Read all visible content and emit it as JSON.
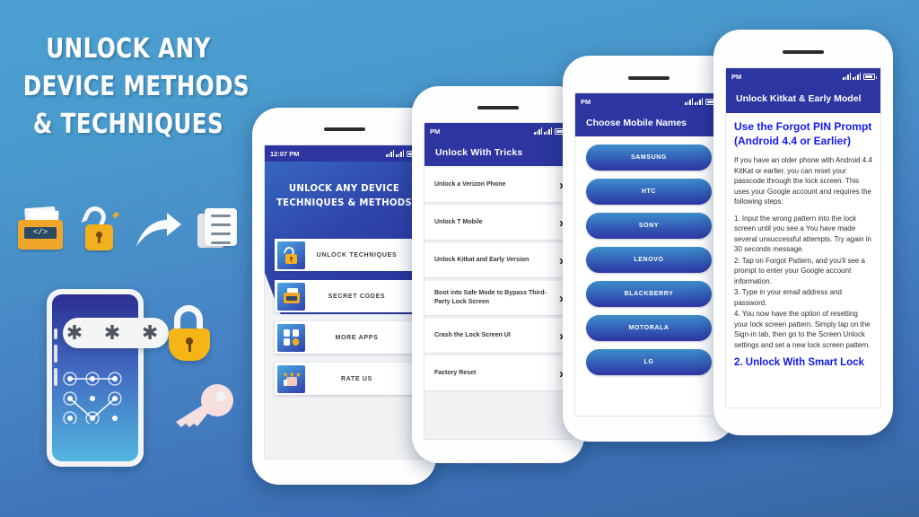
{
  "background": {
    "top_color": "#4b9fd0",
    "bottom_color": "#38679f"
  },
  "headline": {
    "line1": "UNLOCK ANY",
    "line2": "DEVICE METHODS",
    "line3": "& TECHNIQUES"
  },
  "decor_icons": [
    {
      "name": "folder-code-icon",
      "code_label": "</>"
    },
    {
      "name": "unlocked-padlock-icon"
    },
    {
      "name": "forward-arrow-icon"
    },
    {
      "name": "documents-icon"
    }
  ],
  "illustration": {
    "name": "phone-pattern-lock-illustration",
    "password_mask": "✱ ✱ ✱",
    "lock_icon": "padlock-open-icon",
    "key_icon": "key-icon"
  },
  "phones": [
    {
      "id": "phone-home",
      "statusbar": {
        "time": "12:07 PM",
        "signal": "signal-bars-icon",
        "battery": "battery-icon"
      },
      "hero_title_line1": "UNLOCK ANY DEVICE",
      "hero_title_line2": "TECHNIQUES & METHODS",
      "tiles": [
        {
          "label": "UNLOCK TECHNIQUES",
          "icon": "unlock-techniques-icon"
        },
        {
          "label": "SECRET CODES",
          "icon": "secret-codes-icon"
        },
        {
          "label": "MORE APPS",
          "icon": "more-apps-icon"
        },
        {
          "label": "RATE US",
          "icon": "rate-us-icon"
        }
      ]
    },
    {
      "id": "phone-tricks",
      "statusbar": {
        "time": "PM",
        "signal": "signal-bars-icon",
        "battery": "battery-icon"
      },
      "appbar_title": "Unlock With Tricks",
      "rows": [
        {
          "label": "Unlock a Verizon Phone"
        },
        {
          "label": "Unlock T Mobile"
        },
        {
          "label": "Unlock Kitkat and Early Version"
        },
        {
          "label": "Boot into Safe Mode to Bypass Third-Party Lock Screen"
        },
        {
          "label": "Crash the Lock Screen UI"
        },
        {
          "label": "Factory Reset"
        }
      ],
      "chevron": "›"
    },
    {
      "id": "phone-brands",
      "statusbar": {
        "time": "PM",
        "signal": "signal-bars-icon",
        "battery": "battery-icon"
      },
      "appbar_title": "Choose Mobile Names",
      "brands": [
        "SAMSUNG",
        "HTC",
        "SONY",
        "LENOVO",
        "BLACKBERRY",
        "MOTORALA",
        "LG"
      ]
    },
    {
      "id": "phone-article",
      "statusbar": {
        "time": "PM",
        "signal": "signal-bars-icon",
        "battery": "battery-icon"
      },
      "appbar_title": "Unlock Kitkat & Early Model",
      "heading": "Use the Forgot PIN Prompt (Android 4.4 or Earlier)",
      "intro": "If you have an older phone with Android 4.4 KitKat or earlier, you can reset your passcode through the lock screen. This uses your Google account and requires the following steps:",
      "steps": [
        "1. Input the wrong pattern into the lock screen until you see a You have made several unsuccessful attempts. Try again in 30 seconds message.",
        "2. Tap on Forgot Pattern, and you'll see a prompt to enter your Google account information.",
        "3. Type in your email address and password.",
        "4. You now have the option of resetting your lock screen pattern. Simply tap on the Sign-in tab, then go to the Screen Unlock settings and set a new lock screen pattern."
      ],
      "next_link": "2. Unlock With Smart Lock"
    }
  ]
}
